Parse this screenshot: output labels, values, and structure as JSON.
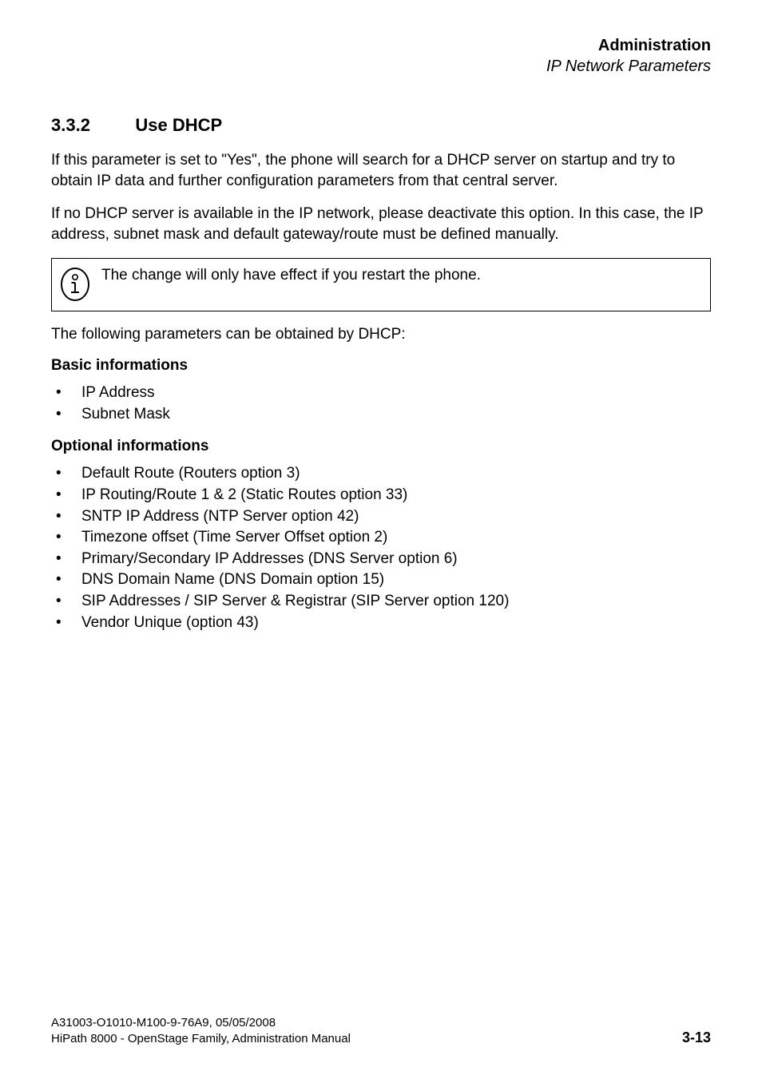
{
  "header": {
    "title": "Administration",
    "subtitle": "IP Network Parameters"
  },
  "section": {
    "number": "3.3.2",
    "title": "Use DHCP"
  },
  "paragraphs": {
    "p1": "If this parameter is set to \"Yes\", the phone will search for a DHCP server on startup and try to obtain IP data and further configuration parameters from that central server.",
    "p2": "If no DHCP server is available in the IP network, please deactivate this option. In this case, the IP address, subnet mask and default gateway/route must be defined manually.",
    "note": "The change will only have effect if you restart the phone.",
    "p3": "The following parameters can be obtained by DHCP:"
  },
  "basicHeading": "Basic informations",
  "basicList": [
    "IP Address",
    "Subnet Mask"
  ],
  "optionalHeading": "Optional informations",
  "optionalList": [
    "Default Route (Routers option 3)",
    "IP Routing/Route 1 & 2 (Static Routes option 33)",
    "SNTP IP Address (NTP Server option 42)",
    "Timezone offset (Time Server Offset option 2)",
    "Primary/Secondary IP Addresses (DNS Server option 6)",
    "DNS Domain Name (DNS Domain option 15)",
    "SIP Addresses / SIP Server & Registrar (SIP Server option 120)",
    "Vendor Unique (option 43)"
  ],
  "footer": {
    "line1": "A31003-O1010-M100-9-76A9, 05/05/2008",
    "line2": "HiPath 8000 - OpenStage Family, Administration Manual",
    "pageNum": "3-13"
  },
  "icons": {
    "noteIconName": "info-icon"
  }
}
